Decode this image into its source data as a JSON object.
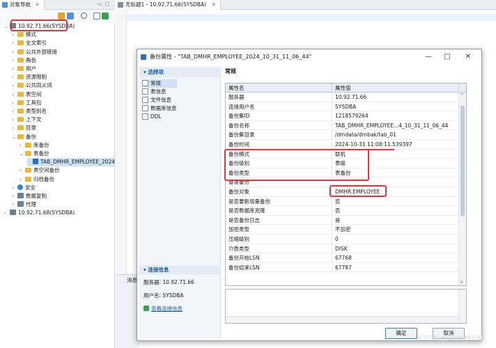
{
  "nav": {
    "tab_label": "对象导航",
    "tree": [
      {
        "label": "10.92.71.66(SYSDBA)",
        "level": 0,
        "icon": "database-icon",
        "expanded": true
      },
      {
        "label": "模式",
        "level": 1,
        "icon": "folder-icon"
      },
      {
        "label": "全文索引",
        "level": 1,
        "icon": "folder-icon"
      },
      {
        "label": "公共外部链接",
        "level": 1,
        "icon": "folder-icon"
      },
      {
        "label": "角色",
        "level": 1,
        "icon": "folder-icon"
      },
      {
        "label": "用户",
        "level": 1,
        "icon": "folder-icon"
      },
      {
        "label": "资源限制",
        "level": 1,
        "icon": "folder-icon"
      },
      {
        "label": "公共同义词",
        "level": 1,
        "icon": "folder-icon"
      },
      {
        "label": "表空间",
        "level": 1,
        "icon": "folder-icon"
      },
      {
        "label": "工具包",
        "level": 1,
        "icon": "folder-icon"
      },
      {
        "label": "类型别名",
        "level": 1,
        "icon": "folder-icon"
      },
      {
        "label": "上下文",
        "level": 1,
        "icon": "folder-icon"
      },
      {
        "label": "目录",
        "level": 1,
        "icon": "folder-icon"
      },
      {
        "label": "备份",
        "level": 1,
        "icon": "folder-icon",
        "expanded": true
      },
      {
        "label": "库备份",
        "level": 2,
        "icon": "folder-icon"
      },
      {
        "label": "表备份",
        "level": 2,
        "icon": "folder-icon",
        "expanded": true
      },
      {
        "label": "TAB_DMHR_EMPLOYEE_2024",
        "level": 3,
        "icon": "table-icon",
        "selected": true
      },
      {
        "label": "表空间备份",
        "level": 2,
        "icon": "folder-icon"
      },
      {
        "label": "归档备份",
        "level": 2,
        "icon": "folder-icon"
      },
      {
        "label": "安全",
        "level": 1,
        "icon": "shield-icon"
      },
      {
        "label": "数据复制",
        "level": 1,
        "icon": "replication-icon"
      },
      {
        "label": "代理",
        "level": 1,
        "icon": "agent-icon"
      },
      {
        "label": "10.92.71.68(SYSDBA)",
        "level": 0,
        "icon": "database-icon"
      }
    ]
  },
  "editor": {
    "tab_label": "无标题1 - 10.92.71.66(SYSDBA)",
    "bottom_tab": "消息"
  },
  "dialog": {
    "title": "备份属性 - \"TAB_DMHR_EMPLOYEE_2024_10_31_11_06_44\"",
    "left": {
      "select_section": "选择项",
      "items": [
        "常规",
        "表信息",
        "文件信息",
        "数据库信息",
        "DDL"
      ],
      "conn_section": "连接信息",
      "server_label": "服务器: 10.92.71.66",
      "user_label": "用户名: SYSDBA",
      "view_conn_link": "查看连接信息"
    },
    "page_title": "常规",
    "grid": {
      "col_name": "属性名",
      "col_value": "属性值",
      "rows": [
        {
          "name": "服务器",
          "value": "10.92.71.66"
        },
        {
          "name": "连接用户名",
          "value": "SYSDBA"
        },
        {
          "name": "备份集ID",
          "value": "1218579264"
        },
        {
          "name": "备份名称",
          "value": "TAB_DMHR_EMPLOYEE...4_10_31_11_06_44"
        },
        {
          "name": "备份集目录",
          "value": "/dmdata/dmbak/tab_01"
        },
        {
          "name": "备份时间",
          "value": "2024-10-31 11:08:11.539397"
        },
        {
          "name": "备份模式",
          "value": "联机"
        },
        {
          "name": "备份级别",
          "value": "表级"
        },
        {
          "name": "备份类型",
          "value": "表备份"
        },
        {
          "name": "基准备份",
          "value": ""
        },
        {
          "name": "备份对象",
          "value": "DMHR.EMPLOYEE"
        },
        {
          "name": "是否要新增量备份",
          "value": "否"
        },
        {
          "name": "是否数据库克隆",
          "value": "否"
        },
        {
          "name": "是否备份日志",
          "value": "是"
        },
        {
          "name": "加密类型",
          "value": "不加密"
        },
        {
          "name": "压缩级别",
          "value": "0"
        },
        {
          "name": "介质类型",
          "value": "DISK"
        },
        {
          "name": "备份开始LSN",
          "value": "67768"
        },
        {
          "name": "备份结束LSN",
          "value": "67787"
        }
      ]
    },
    "ok_label": "确定",
    "cancel_label": "取消"
  },
  "watermark": "CSDN @zm888886",
  "colors": {
    "highlight_box": "#e8323c",
    "link": "#1c5a9c",
    "selection": "#cde3f7"
  }
}
